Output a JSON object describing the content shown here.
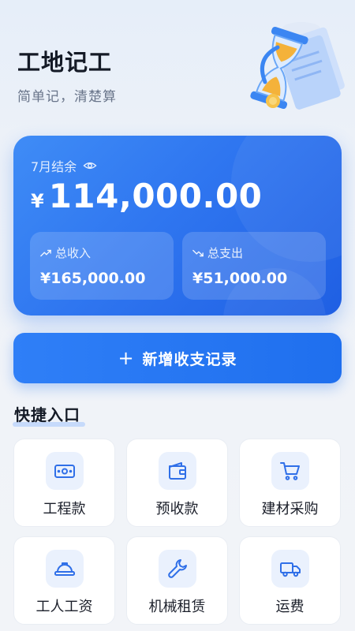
{
  "header": {
    "title": "工地记工",
    "subtitle": "简单记，清楚算"
  },
  "summary": {
    "period_label": "7月结余",
    "currency": "¥",
    "balance": "114,000.00",
    "income": {
      "label": "总收入",
      "value": "¥165,000.00"
    },
    "expense": {
      "label": "总支出",
      "value": "¥51,000.00"
    }
  },
  "add_button": {
    "icon": "+",
    "label": "新增收支记录"
  },
  "quick_access": {
    "title": "快捷入口",
    "items": [
      {
        "label": "工程款",
        "icon": "banknote-icon"
      },
      {
        "label": "预收款",
        "icon": "wallet-icon"
      },
      {
        "label": "建材采购",
        "icon": "cart-icon"
      },
      {
        "label": "工人工资",
        "icon": "hardhat-icon"
      },
      {
        "label": "机械租赁",
        "icon": "wrench-icon"
      },
      {
        "label": "运费",
        "icon": "truck-icon"
      }
    ]
  },
  "colors": {
    "primary": "#2f76f0",
    "icon_blue": "#2f6fe8",
    "icon_bg": "#eaf1fd"
  }
}
